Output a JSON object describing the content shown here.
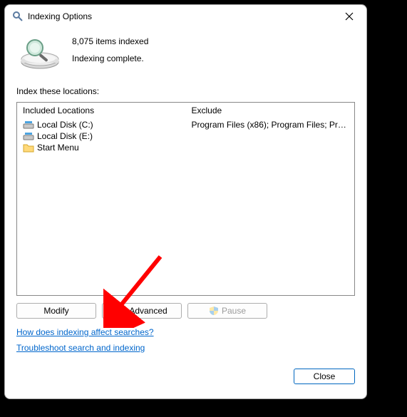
{
  "window": {
    "title": "Indexing Options"
  },
  "status": {
    "items_indexed": "8,075 items indexed",
    "state": "Indexing complete."
  },
  "locations_label": "Index these locations:",
  "columns": {
    "included": "Included Locations",
    "exclude": "Exclude"
  },
  "included": [
    {
      "label": "Local Disk (C:)",
      "exclude": "Program Files (x86); Program Files; Progra..."
    },
    {
      "label": "Local Disk (E:)",
      "exclude": ""
    },
    {
      "label": "Start Menu",
      "exclude": ""
    }
  ],
  "buttons": {
    "modify": "Modify",
    "advanced": "Advanced",
    "pause": "Pause",
    "close": "Close"
  },
  "links": {
    "how": "How does indexing affect searches?",
    "troubleshoot": "Troubleshoot search and indexing"
  }
}
